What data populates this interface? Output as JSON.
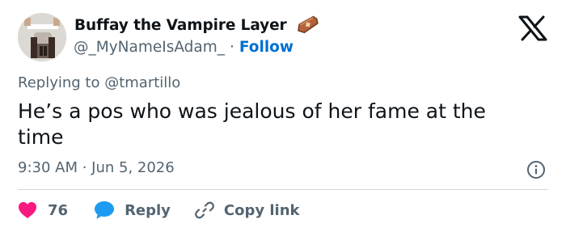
{
  "author": {
    "display_name": "Buffay the Vampire Layer",
    "handle": "@_MyNameIsAdam_",
    "separator": "·",
    "follow_label": "Follow",
    "emoji_icon": "coffin-icon"
  },
  "reply_to": {
    "prefix": "Replying to",
    "mention": "@tmartillo"
  },
  "tweet": {
    "text": "He’s a pos who was jealous of her fame at the time",
    "timestamp": "9:30 AM · Jun 5, 2026"
  },
  "actions": {
    "like_count": "76",
    "reply_label": "Reply",
    "copy_label": "Copy link"
  },
  "colors": {
    "link": "#0070d0",
    "like": "#f91880",
    "reply": "#1d9bf0",
    "muted": "#536471"
  },
  "icons": [
    "x-logo-icon",
    "info-icon",
    "heart-icon",
    "reply-bubble-icon",
    "link-icon",
    "coffin-icon"
  ]
}
